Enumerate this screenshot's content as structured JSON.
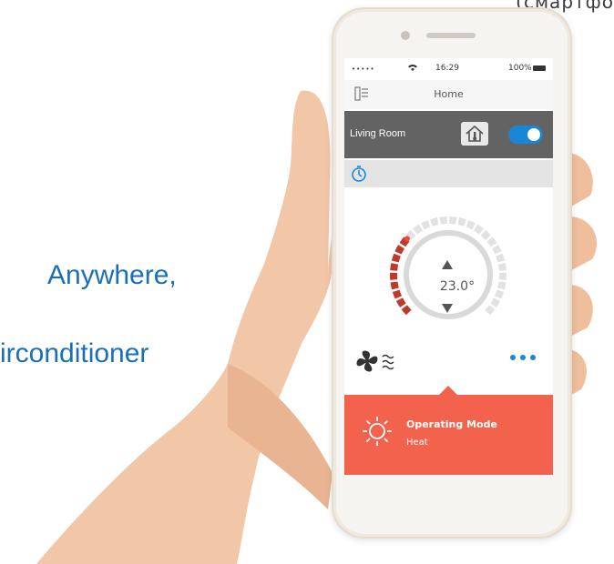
{
  "background": {
    "top_right_text": "(смартфо",
    "slogan_line1": "Anywhere,",
    "slogan_line2": "irconditioner"
  },
  "status_bar": {
    "signal": "•••••",
    "wifi_icon": "wifi-icon",
    "time": "16:29",
    "battery_percent": "100%"
  },
  "nav": {
    "title": "Home",
    "menu_icon": "thermostat-menu-icon"
  },
  "room": {
    "name": "Living Room",
    "home_icon": "home-thermometer-icon",
    "power_on": true
  },
  "timer": {
    "icon": "timer-icon"
  },
  "thermostat": {
    "temperature": "23.0°",
    "setpoint_level": 0.32,
    "accent": "#c0392b"
  },
  "controls": {
    "fan_icon": "fan-airflow-icon",
    "more_icon": "more-dots-icon"
  },
  "operating_mode": {
    "title": "Operating Mode",
    "value": "Heat",
    "icon": "sun-heat-icon",
    "color": "#f2624c"
  }
}
